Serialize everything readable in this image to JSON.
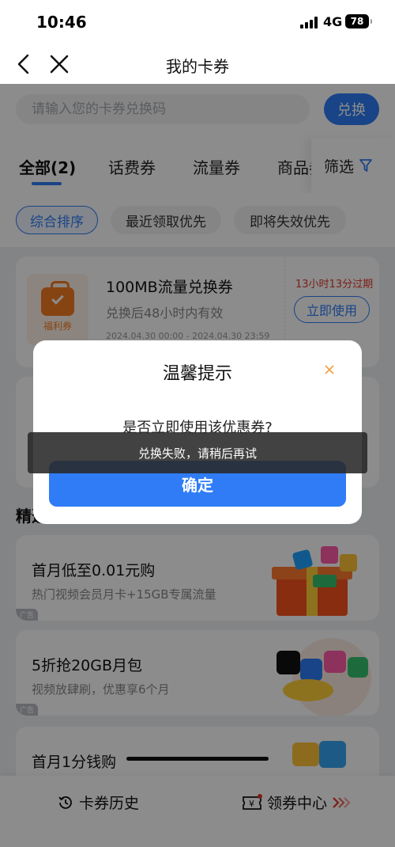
{
  "status": {
    "time": "10:46",
    "network": "4G",
    "battery": "78"
  },
  "nav": {
    "title": "我的卡券"
  },
  "search": {
    "placeholder": "请输入您的卡券兑换码",
    "button": "兑换"
  },
  "tabs": {
    "items": [
      "全部(2)",
      "话费券",
      "流量券",
      "商品券"
    ],
    "filter": "筛选"
  },
  "sort": {
    "items": [
      "综合排序",
      "最近领取优先",
      "即将失效优先"
    ]
  },
  "coupon": {
    "icon_label": "福利券",
    "title": "100MB流量兑换券",
    "desc": "兑换后48小时内有效",
    "date": "2024.04.30 00:00 - 2024.04.30 23:59",
    "expire": "13小时13分过期",
    "use_button": "立即使用"
  },
  "section": {
    "title": "精选"
  },
  "promos": [
    {
      "title": "首月低至0.01元购",
      "desc": "热门视频会员月卡+15GB专属流量",
      "tag": "广告"
    },
    {
      "title": "5折抢20GB月包",
      "desc": "视频放肆刷，优惠享6个月",
      "tag": "广告"
    },
    {
      "title": "首月1分钱购",
      "desc": "",
      "tag": ""
    }
  ],
  "bottom": {
    "history": "卡券历史",
    "center": "领券中心"
  },
  "dialog": {
    "title": "温馨提示",
    "message": "是否立即使用该优惠券?",
    "confirm": "确定"
  },
  "toast": {
    "message": "兑换失败，请稍后再试"
  },
  "colors": {
    "primary": "#2f7cf6",
    "warning": "#e0382e",
    "orange": "#f47d22"
  }
}
